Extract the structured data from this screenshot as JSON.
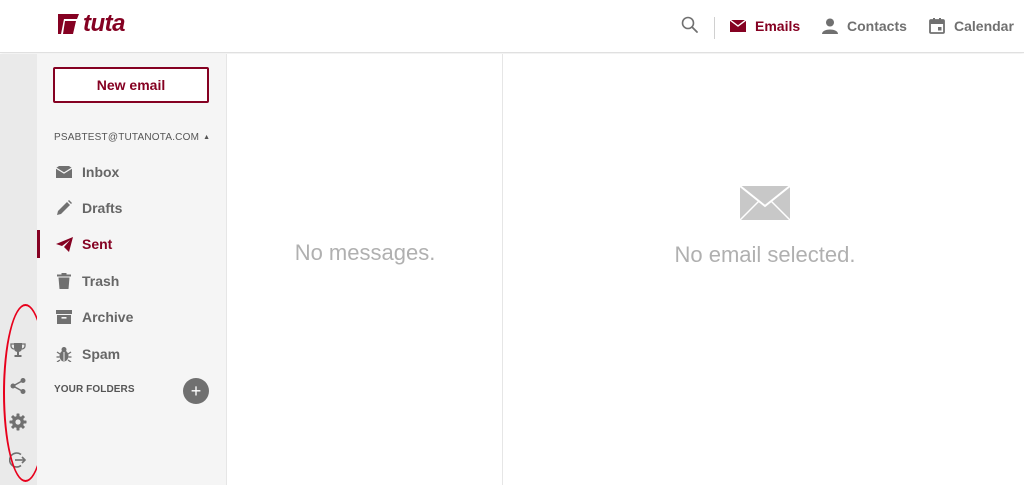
{
  "app": {
    "logo_text": "tuta",
    "brand_color": "#850122"
  },
  "header": {
    "search_icon": "search-icon",
    "nav": [
      {
        "label": "Emails",
        "icon": "envelope-icon",
        "active": true
      },
      {
        "label": "Contacts",
        "icon": "person-icon",
        "active": false
      },
      {
        "label": "Calendar",
        "icon": "calendar-icon",
        "active": false
      }
    ]
  },
  "rail": {
    "icons": [
      "trophy-icon",
      "share-icon",
      "gear-icon",
      "logout-icon"
    ],
    "highlight_color": "#e8001c"
  },
  "sidebar": {
    "new_email_label": "New email",
    "account": "PSABTEST@TUTANOTA.COM",
    "folders": [
      {
        "label": "Inbox",
        "icon": "inbox-icon",
        "active": false
      },
      {
        "label": "Drafts",
        "icon": "pencil-icon",
        "active": false
      },
      {
        "label": "Sent",
        "icon": "paper-plane-icon",
        "active": true
      },
      {
        "label": "Trash",
        "icon": "trash-icon",
        "active": false
      },
      {
        "label": "Archive",
        "icon": "archive-icon",
        "active": false
      },
      {
        "label": "Spam",
        "icon": "bug-icon",
        "active": false
      }
    ],
    "your_folders_label": "YOUR FOLDERS",
    "add_folder_symbol": "+"
  },
  "message_list": {
    "empty_text": "No messages."
  },
  "viewer": {
    "empty_text": "No email selected."
  }
}
